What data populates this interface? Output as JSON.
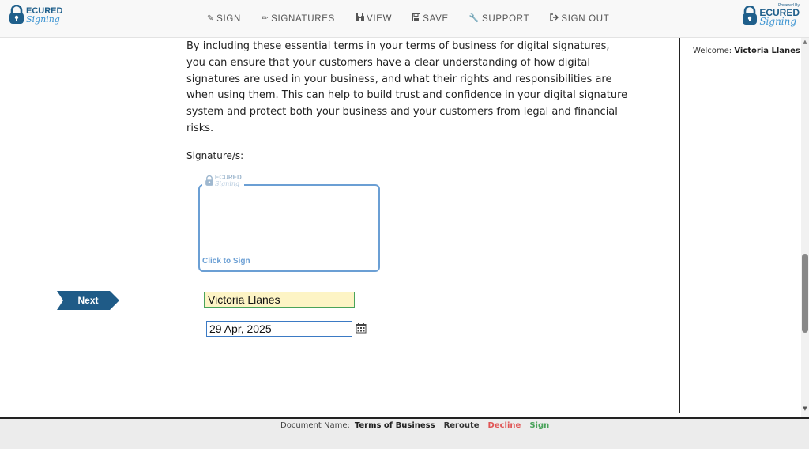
{
  "header": {
    "logo_left": {
      "line1": "ECURED",
      "line2": "Signing"
    },
    "logo_right": {
      "line1": "ECURED",
      "line2": "Signing",
      "powered": "Powered By"
    },
    "nav": [
      {
        "label": "SIGN",
        "icon": "edit-icon"
      },
      {
        "label": "SIGNATURES",
        "icon": "pencil-icon"
      },
      {
        "label": "VIEW",
        "icon": "binoculars-icon"
      },
      {
        "label": "SAVE",
        "icon": "save-icon"
      },
      {
        "label": "SUPPORT",
        "icon": "wrench-icon"
      },
      {
        "label": "SIGN OUT",
        "icon": "sign-out-icon"
      }
    ]
  },
  "document": {
    "paragraph": "By including these essential terms in your terms of business for digital signatures, you can ensure that your customers have a clear understanding of how digital signatures are used in your business, and what their rights and responsibilities are when using them. This can help to build trust and confidence in your digital signature system and protect both your business and your customers from legal and financial risks.",
    "signature_heading": "Signature/s:",
    "signature_box": {
      "logo_line1": "ECURED",
      "logo_line2": "Signing",
      "click_label": "Click to Sign"
    },
    "next_label": "Next",
    "name_value": "Victoria Llanes",
    "date_value": "29 Apr, 2025"
  },
  "sidebar": {
    "welcome_label": "Welcome:",
    "user_name": "Victoria Llanes"
  },
  "footer": {
    "doc_label": "Document Name:",
    "doc_name": "Terms of Business",
    "reroute": "Reroute",
    "decline": "Decline",
    "sign": "Sign"
  },
  "colors": {
    "brand_dark": "#1f5f8b",
    "brand_light": "#3a93d1",
    "next_tag": "#1f5b87",
    "decline": "#e05454",
    "sign": "#49a35a",
    "name_field_bg": "#fdf4c5"
  }
}
